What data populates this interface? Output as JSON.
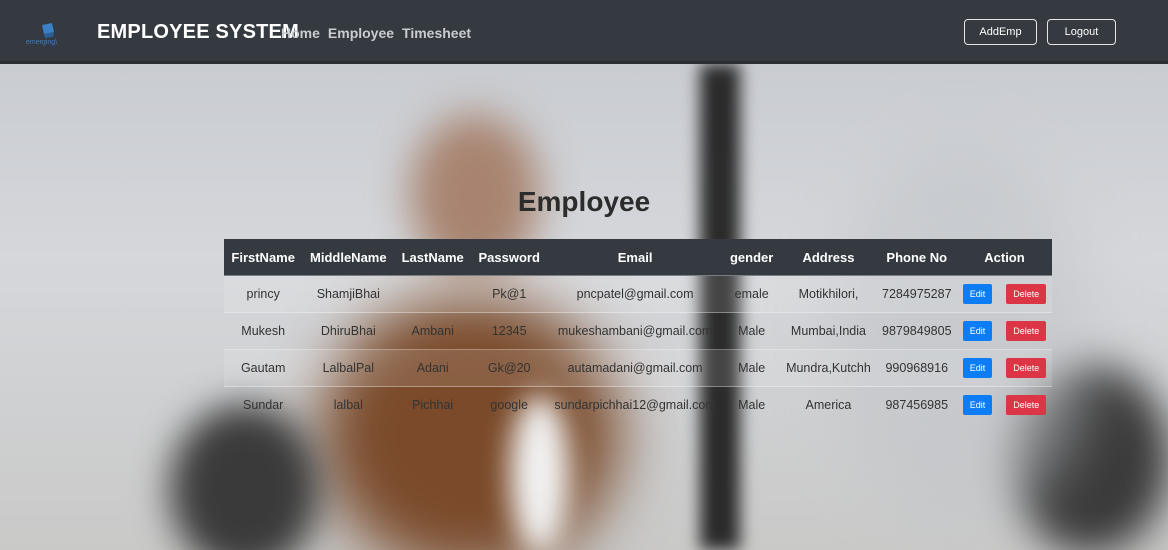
{
  "navbar": {
    "logo_text": "emerging\\",
    "brand": "EMPLOYEE SYSTEM",
    "links": [
      "Home",
      "Employee",
      "Timesheet"
    ],
    "add_button": "AddEmp",
    "logout_button": "Logout"
  },
  "main": {
    "title": "Employee",
    "columns": [
      "FirstName",
      "MiddleName",
      "LastName",
      "Password",
      "Email",
      "gender",
      "Address",
      "Phone No",
      "Action"
    ],
    "rows": [
      {
        "first": "princy",
        "middle": "ShamjiBhai",
        "last": "",
        "password": "Pk@1",
        "email": "pncpatel@gmail.com",
        "gender": "emale",
        "address": "Motikhilori,",
        "phone": "7284975287"
      },
      {
        "first": "Mukesh",
        "middle": "DhiruBhai",
        "last": "Ambani",
        "password": "12345",
        "email": "mukeshambani@gmail.com",
        "gender": "Male",
        "address": "Mumbai,India",
        "phone": "9879849805"
      },
      {
        "first": "Gautam",
        "middle": "LalbalPal",
        "last": "Adani",
        "password": "Gk@20",
        "email": "autamadani@gmail.com",
        "gender": "Male",
        "address": "Mundra,Kutchh",
        "phone": "990968916"
      },
      {
        "first": "Sundar",
        "middle": "lalbal",
        "last": "Pichhai",
        "password": "google",
        "email": "sundarpichhai12@gmail.com",
        "gender": "Male",
        "address": "America",
        "phone": "987456985"
      }
    ],
    "edit_label": "Edit",
    "delete_label": "Delete"
  },
  "colors": {
    "navbar": "#343a40",
    "edit": "#0d7df5",
    "delete": "#dc3545"
  }
}
